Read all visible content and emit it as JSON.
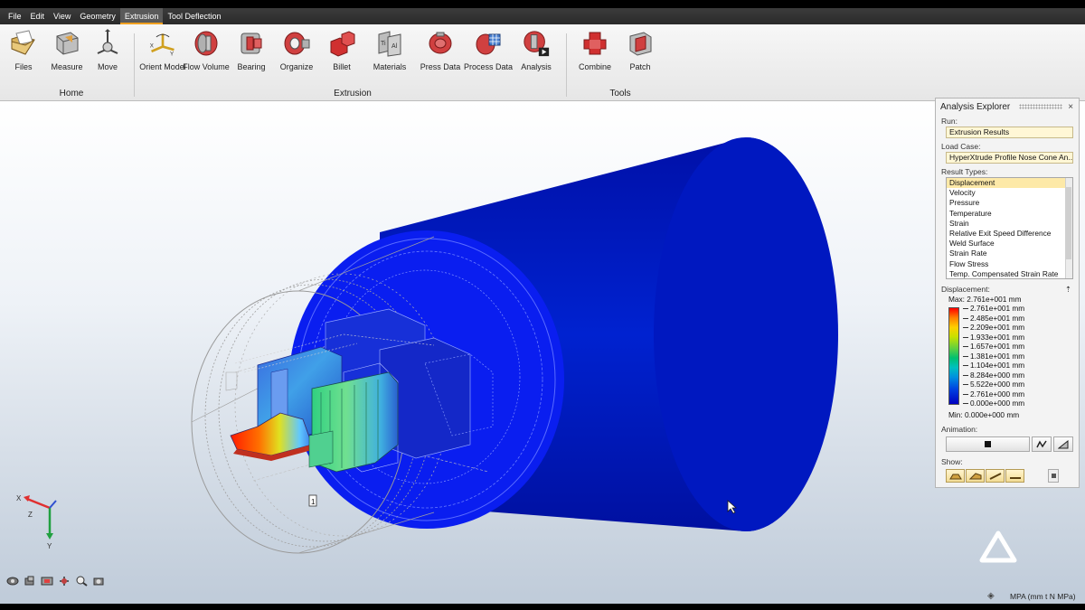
{
  "menu": [
    "File",
    "Edit",
    "View",
    "Geometry",
    "Extrusion",
    "Tool Deflection"
  ],
  "menu_active": "Extrusion",
  "ribbon": {
    "buttons": [
      {
        "label": "Files",
        "icon": "folder-icon"
      },
      {
        "label": "Measure",
        "icon": "measure-icon"
      },
      {
        "label": "Move",
        "icon": "move-icon"
      },
      {
        "label": "Orient Model",
        "icon": "orient-model-icon"
      },
      {
        "label": "Flow Volume",
        "icon": "flow-volume-icon"
      },
      {
        "label": "Bearing",
        "icon": "bearing-icon"
      },
      {
        "label": "Organize",
        "icon": "organize-icon"
      },
      {
        "label": "Billet",
        "icon": "billet-icon"
      },
      {
        "label": "Materials",
        "icon": "materials-icon"
      },
      {
        "label": "Press Data",
        "icon": "press-data-icon"
      },
      {
        "label": "Process Data",
        "icon": "process-data-icon"
      },
      {
        "label": "Analysis",
        "icon": "analysis-icon"
      },
      {
        "label": "Combine",
        "icon": "combine-icon"
      },
      {
        "label": "Patch",
        "icon": "patch-icon"
      }
    ],
    "groups": [
      "Home",
      "Extrusion",
      "Tools"
    ]
  },
  "panel": {
    "title": "Analysis Explorer",
    "close": "×",
    "run_label": "Run:",
    "run_value": "Extrusion Results",
    "loadcase_label": "Load Case:",
    "loadcase_value": "HyperXtrude Profile Nose Cone An...",
    "result_types_label": "Result Types:",
    "result_types": [
      "Displacement",
      "Velocity",
      "Pressure",
      "Temperature",
      "Strain",
      "Relative Exit Speed Difference",
      "Weld Surface",
      "Strain Rate",
      "Flow Stress",
      "Temp. Compensated Strain Rate"
    ],
    "selected_result": "Displacement",
    "legend_title": "Displacement:",
    "legend_max": "Max:  2.761e+001 mm",
    "legend_min": "Min:  0.000e+000 mm",
    "legend_ticks": [
      "2.761e+001 mm",
      "2.485e+001 mm",
      "2.209e+001 mm",
      "1.933e+001 mm",
      "1.657e+001 mm",
      "1.381e+001 mm",
      "1.104e+001 mm",
      "8.284e+000 mm",
      "5.522e+000 mm",
      "2.761e+000 mm",
      "0.000e+000 mm"
    ],
    "animation_label": "Animation:",
    "show_label": "Show:"
  },
  "status": {
    "units": "MPA (mm t N MPa)"
  },
  "axis_labels": {
    "x": "X",
    "y": "Y",
    "z": "Z"
  },
  "marker_label": "1"
}
